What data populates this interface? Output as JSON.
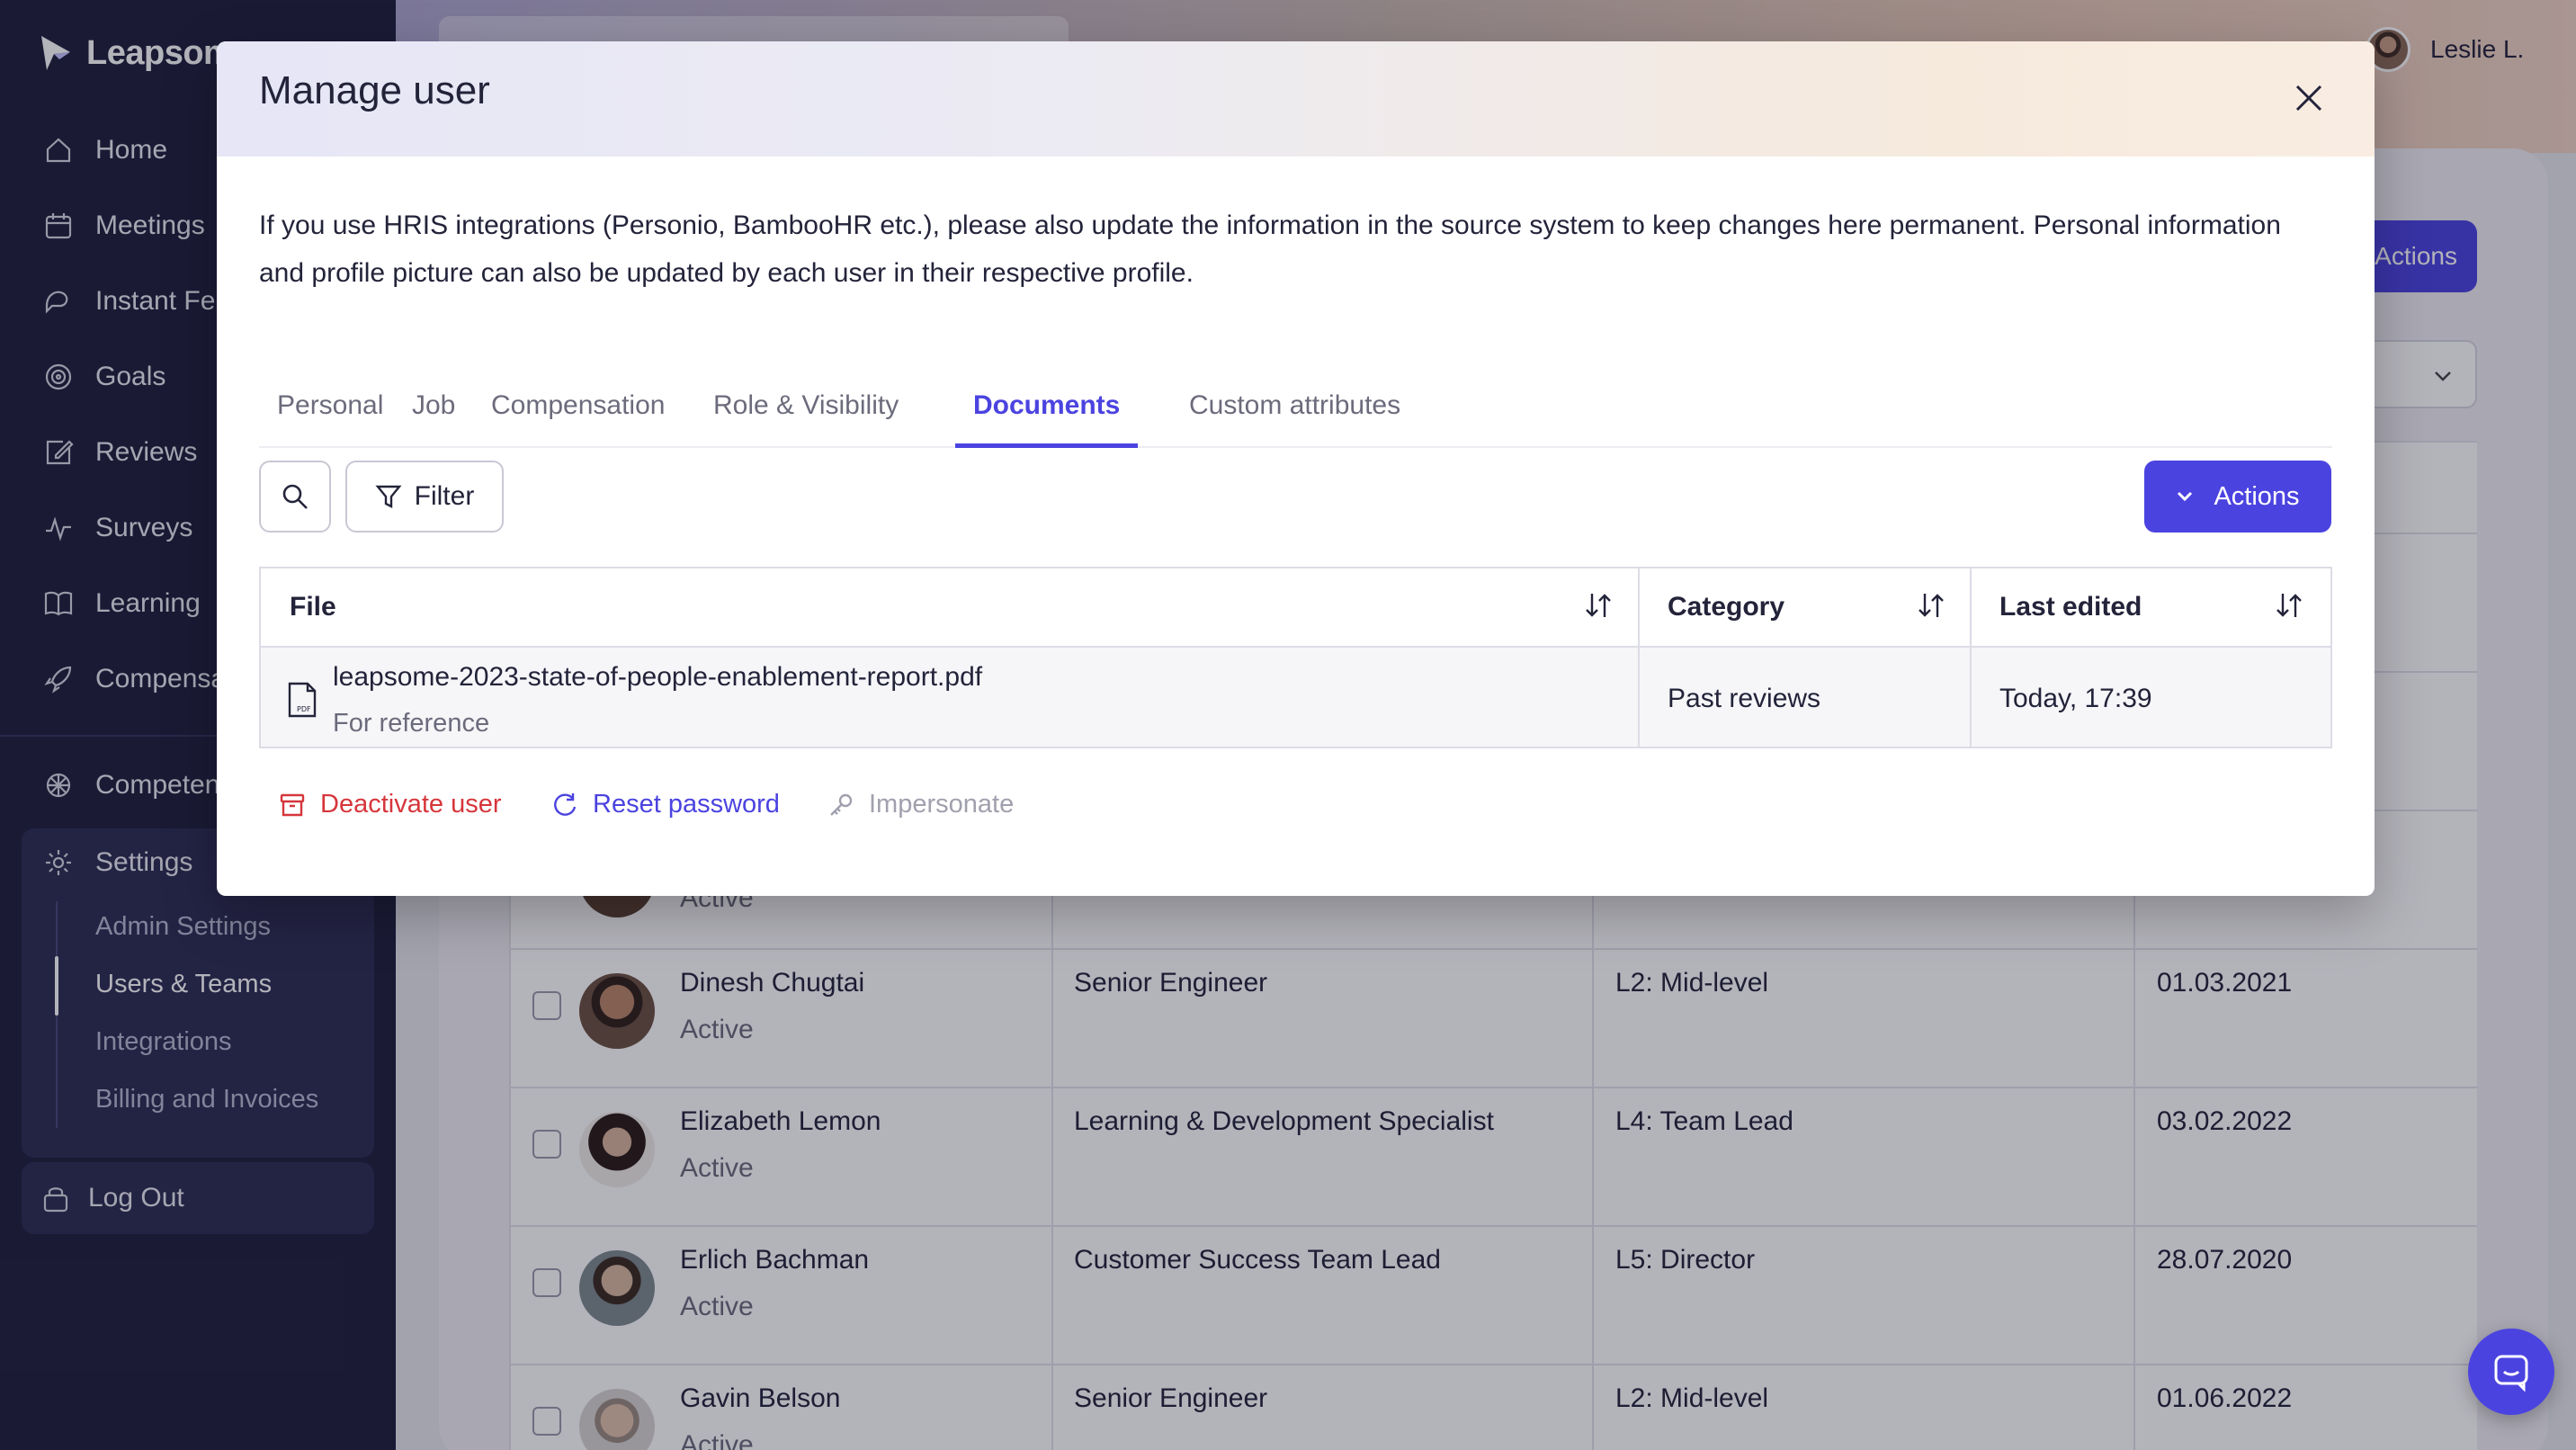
{
  "app": {
    "brand": "Leapsome"
  },
  "sidebar": {
    "items": [
      {
        "label": "Home",
        "icon": "home-icon"
      },
      {
        "label": "Meetings",
        "icon": "calendar-icon"
      },
      {
        "label": "Instant Fe",
        "icon": "feedback-icon"
      },
      {
        "label": "Goals",
        "icon": "target-icon"
      },
      {
        "label": "Reviews",
        "icon": "edit-icon"
      },
      {
        "label": "Surveys",
        "icon": "pulse-icon"
      },
      {
        "label": "Learning",
        "icon": "book-icon"
      },
      {
        "label": "Compensa",
        "icon": "rocket-icon"
      },
      {
        "label": "Competen",
        "icon": "competency-icon"
      },
      {
        "label": "Settings",
        "icon": "gear-icon"
      }
    ],
    "settings_sub": [
      {
        "label": "Admin Settings"
      },
      {
        "label": "Users & Teams"
      },
      {
        "label": "Integrations"
      },
      {
        "label": "Billing and Invoices"
      }
    ],
    "logout_label": "Log Out"
  },
  "header": {
    "user_name": "Leslie L."
  },
  "background": {
    "actions_label": "Actions",
    "partial_status": "Active",
    "rows": [
      {
        "name": "Dinesh Chugtai",
        "status": "Active",
        "title": "Senior Engineer",
        "level": "L2: Mid-level",
        "date": "01.03.2021"
      },
      {
        "name": "Elizabeth Lemon",
        "status": "Active",
        "title": "Learning & Development Specialist",
        "level": "L4: Team Lead",
        "date": "03.02.2022"
      },
      {
        "name": "Erlich Bachman",
        "status": "Active",
        "title": "Customer Success Team Lead",
        "level": "L5: Director",
        "date": "28.07.2020"
      },
      {
        "name": "Gavin Belson",
        "status": "Active",
        "title": "Senior Engineer",
        "level": "L2: Mid-level",
        "date": "01.06.2022"
      }
    ]
  },
  "modal": {
    "title": "Manage user",
    "info_line1": "If you use HRIS integrations (Personio, BambooHR etc.), please also update the information in the source system to keep changes here permanent. Personal information",
    "info_line2": "and profile picture can also be updated by each user in their respective profile.",
    "tabs": [
      {
        "label": "Personal"
      },
      {
        "label": "Job"
      },
      {
        "label": "Compensation"
      },
      {
        "label": "Role & Visibility"
      },
      {
        "label": "Documents",
        "active": true
      },
      {
        "label": "Custom attributes"
      }
    ],
    "filter_label": "Filter",
    "actions_label": "Actions",
    "table": {
      "headers": [
        "File",
        "Category",
        "Last edited"
      ],
      "rows": [
        {
          "file": "leapsome-2023-state-of-people-enablement-report.pdf",
          "note": "For reference",
          "category": "Past reviews",
          "last_edited": "Today, 17:39"
        }
      ]
    },
    "footer": {
      "deactivate": "Deactivate user",
      "reset": "Reset password",
      "impersonate": "Impersonate"
    }
  },
  "colors": {
    "sidebar_bg": "#1e1e3c",
    "accent": "#4b43e0",
    "danger": "#d6363b",
    "disabled": "#a0a0ae"
  }
}
